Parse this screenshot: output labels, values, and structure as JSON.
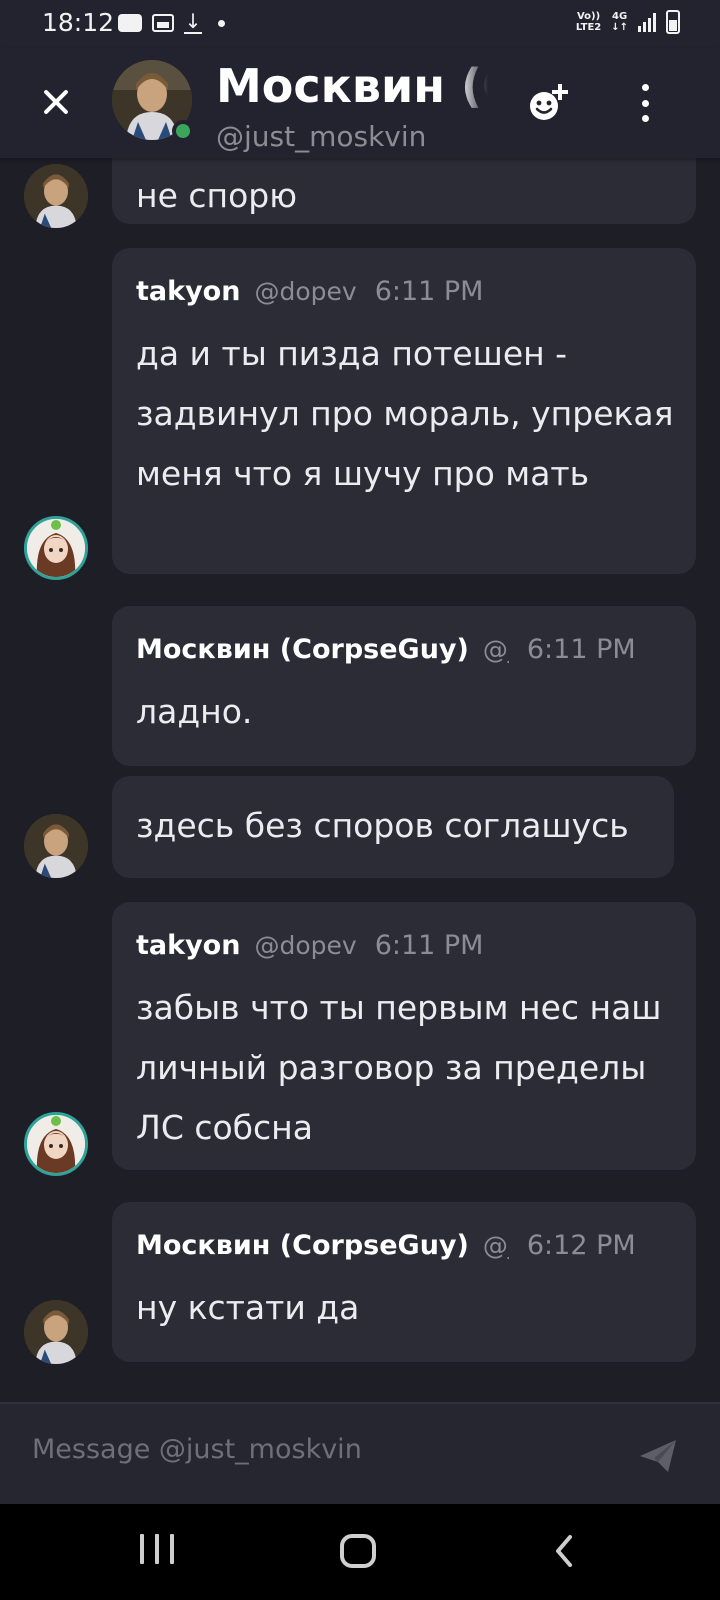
{
  "status_bar": {
    "time": "18:12",
    "volte_top": "Vo))",
    "volte_bottom": "LTE2",
    "network": "4G"
  },
  "header": {
    "title": "Москвин (CorpseGuy)",
    "username": "@just_moskvin",
    "online_color": "#3ba55c"
  },
  "messages": [
    {
      "id": "m0",
      "author": "",
      "handle": "",
      "time": "",
      "text": "не спорю",
      "avatar": "moskvin-avatar"
    },
    {
      "id": "m1",
      "author": "takyon",
      "handle": "@dopev",
      "time": "6:11 PM",
      "text": "да и ты пизда потешен - задвинул про мораль, упрекая меня что я шучу про мать",
      "avatar": "takyon-avatar"
    },
    {
      "id": "m2",
      "author": "Москвин (CorpseGuy)",
      "handle": "@just_moskvin",
      "time": "6:11 PM",
      "text": "ладно.",
      "avatar": ""
    },
    {
      "id": "m3",
      "author": "",
      "handle": "",
      "time": "",
      "text": "здесь без споров соглашусь",
      "avatar": "moskvin-avatar"
    },
    {
      "id": "m4",
      "author": "takyon",
      "handle": "@dopev",
      "time": "6:11 PM",
      "text": "забыв что ты первым нес наш личный разговор за пределы ЛС собсна",
      "avatar": "takyon-avatar"
    },
    {
      "id": "m5",
      "author": "Москвин (CorpseGuy)",
      "handle": "@just_moskvin",
      "time": "6:12 PM",
      "text": "ну кстати да",
      "avatar": "moskvin-avatar"
    }
  ],
  "composer": {
    "placeholder": "Message @just_moskvin"
  },
  "colors": {
    "background": "#1e1e26",
    "bubble": "#2c2c36",
    "header": "#232330",
    "muted": "#8c8c95",
    "accent_teal": "#2fa39a"
  },
  "icons": [
    "close-icon",
    "add-friend-icon",
    "more-options-icon",
    "send-icon",
    "nav-recents-icon",
    "nav-home-icon",
    "nav-back-icon"
  ]
}
